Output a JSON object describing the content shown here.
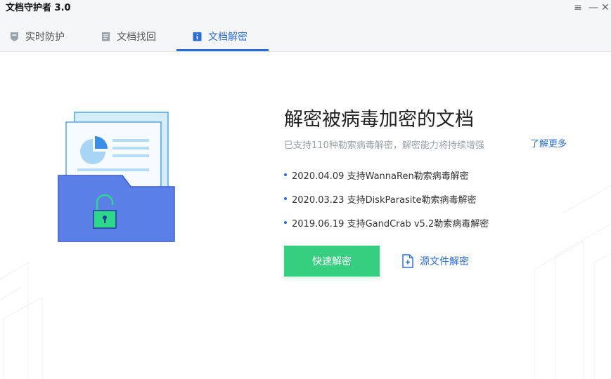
{
  "window": {
    "title": "文档守护者 3.0",
    "menu_glyph": "≡",
    "minimize_glyph": "—",
    "close_glyph": "✕"
  },
  "tabs": [
    {
      "label": "实时防护",
      "icon": "shield-icon",
      "active": false
    },
    {
      "label": "文档找回",
      "icon": "document-icon",
      "active": false
    },
    {
      "label": "文档解密",
      "icon": "info-icon",
      "active": true
    }
  ],
  "main": {
    "headline": "解密被病毒加密的文档",
    "subline": "已支持110种勒索病毒解密，解密能力将持续增强",
    "learn_more": "了解更多",
    "updates": [
      "2020.04.09 支持WannaRen勒索病毒解密",
      "2020.03.23 支持DiskParasite勒索病毒解密",
      "2019.06.19 支持GandCrab v5.2勒索病毒解密"
    ],
    "primary_button": "快速解密",
    "secondary_button": "源文件解密"
  },
  "colors": {
    "accent": "#2a6dd8",
    "primary_button": "#36cf80",
    "folder": "#5a7fe6",
    "lock": "#2ed88a"
  }
}
